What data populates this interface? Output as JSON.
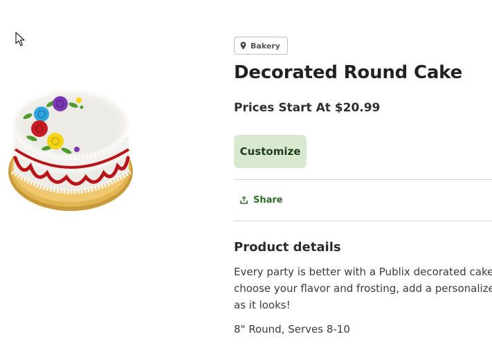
{
  "product": {
    "location_tag": "Bakery",
    "title": "Decorated Round Cake",
    "price": "Prices Start At $20.99",
    "customize_label": "Customize",
    "share_label": "Share",
    "details_heading": "Product details",
    "description_lines": [
      "Every party is better with a Publix decorated cake! You",
      "choose your flavor and frosting, add a personalized",
      "as it looks!"
    ],
    "serving_info": "8\" Round, Serves 8-10"
  },
  "icons": {
    "location": "map-pin-icon",
    "share": "share-upload-icon",
    "cursor": "mouse-cursor-icon"
  },
  "colors": {
    "customize_bg": "#d8e9d0",
    "customize_text": "#1f3d18",
    "share_text": "#2f6b27",
    "divider": "#d4d4d4"
  }
}
